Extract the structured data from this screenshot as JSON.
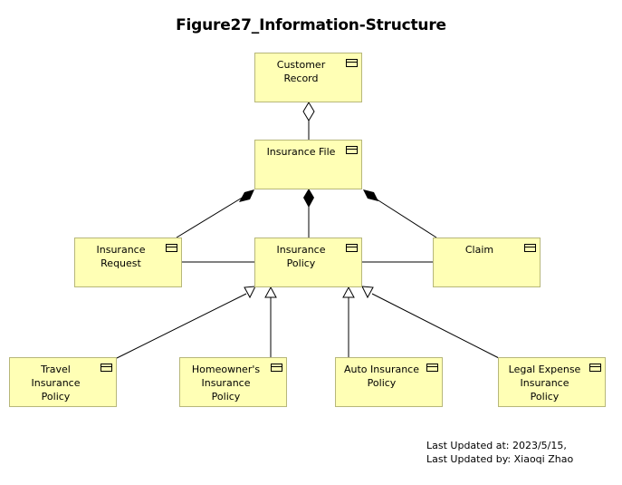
{
  "title": "Figure27_Information-Structure",
  "nodes": {
    "customer_record": {
      "label": "Customer\nRecord",
      "icon": "business-object-icon"
    },
    "insurance_file": {
      "label": "Insurance File",
      "icon": "business-object-icon"
    },
    "insurance_request": {
      "label": "Insurance\nRequest",
      "icon": "business-object-icon"
    },
    "insurance_policy": {
      "label": "Insurance\nPolicy",
      "icon": "business-object-icon"
    },
    "claim": {
      "label": "Claim",
      "icon": "business-object-icon"
    },
    "travel_policy": {
      "label": "Travel\nInsurance\nPolicy",
      "icon": "business-object-icon"
    },
    "homeowner_policy": {
      "label": "Homeowner's\nInsurance\nPolicy",
      "icon": "business-object-icon"
    },
    "auto_policy": {
      "label": "Auto Insurance\nPolicy",
      "icon": "business-object-icon"
    },
    "legal_policy": {
      "label": "Legal Expense\nInsurance\nPolicy",
      "icon": "business-object-icon"
    }
  },
  "relationships": [
    {
      "from": "insurance_file",
      "to": "customer_record",
      "type": "aggregation"
    },
    {
      "from": "insurance_file",
      "to": "insurance_request",
      "type": "composition"
    },
    {
      "from": "insurance_file",
      "to": "insurance_policy",
      "type": "composition"
    },
    {
      "from": "insurance_file",
      "to": "claim",
      "type": "composition"
    },
    {
      "from": "insurance_request",
      "to": "insurance_policy",
      "type": "association"
    },
    {
      "from": "insurance_policy",
      "to": "claim",
      "type": "association"
    },
    {
      "from": "travel_policy",
      "to": "insurance_policy",
      "type": "specialization"
    },
    {
      "from": "homeowner_policy",
      "to": "insurance_policy",
      "type": "specialization"
    },
    {
      "from": "auto_policy",
      "to": "insurance_policy",
      "type": "specialization"
    },
    {
      "from": "legal_policy",
      "to": "insurance_policy",
      "type": "specialization"
    }
  ],
  "footer": {
    "updated_at": "Last Updated at: 2023/5/15,",
    "updated_by": "Last Updated by: Xiaoqi Zhao"
  }
}
